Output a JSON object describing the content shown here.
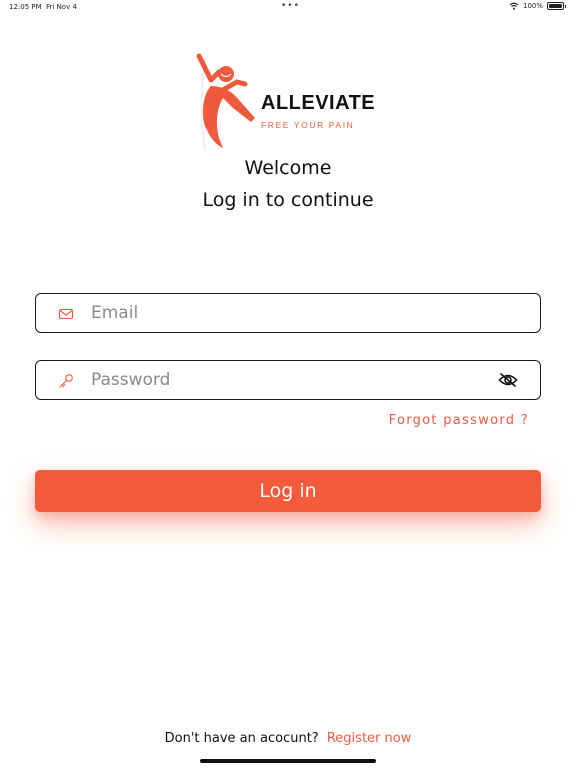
{
  "status_bar": {
    "time": "12:05 PM",
    "date": "Fri Nov 4",
    "dots": "•••",
    "battery_text": "100%",
    "battery_level": 1.0
  },
  "logo": {
    "wordmark": "ALLEVIATE",
    "tagline": "FREE YOUR PAIN",
    "accent_color": "#ef5a3c"
  },
  "header": {
    "welcome": "Welcome",
    "subtitle": "Log in to continue"
  },
  "form": {
    "email": {
      "placeholder": "Email",
      "value": "",
      "icon": "mail-icon"
    },
    "password": {
      "placeholder": "Password",
      "value": "",
      "icon": "key-icon",
      "toggle_icon": "eye-slash-icon"
    },
    "forgot_label": "Forgot password ?",
    "login_label": "Log in"
  },
  "footer": {
    "prompt": "Don't have an acocunt?",
    "register_label": "Register now"
  },
  "colors": {
    "brand": "#f55a3a",
    "text": "#111111",
    "placeholder": "#8a8a8a"
  }
}
